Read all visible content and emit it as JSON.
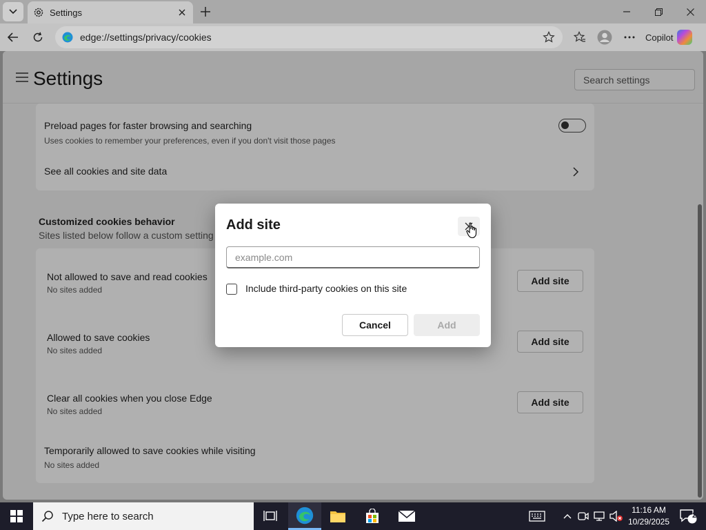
{
  "browser": {
    "tab_title": "Settings",
    "url": "edge://settings/privacy/cookies",
    "copilot_label": "Copilot"
  },
  "header": {
    "title": "Settings",
    "search_placeholder": "Search settings"
  },
  "preload": {
    "title": "Preload pages for faster browsing and searching",
    "subtitle": "Uses cookies to remember your preferences, even if you don't visit those pages",
    "toggle_on": false
  },
  "see_all": {
    "label": "See all cookies and site data"
  },
  "custom": {
    "title": "Customized cookies behavior",
    "subtitle": "Sites listed below follow a custom setting",
    "rows": [
      {
        "title": "Not allowed to save and read cookies",
        "subtitle": "No sites added",
        "button": "Add site"
      },
      {
        "title": "Allowed to save cookies",
        "subtitle": "No sites added",
        "button": "Add site"
      },
      {
        "title": "Clear all cookies when you close Edge",
        "subtitle": "No sites added",
        "button": "Add site"
      }
    ],
    "temp": {
      "title": "Temporarily allowed to save cookies while visiting",
      "subtitle": "No sites added"
    }
  },
  "dialog": {
    "title": "Add site",
    "input_placeholder": "example.com",
    "checkbox_label": "Include third-party cookies on this site",
    "checkbox_checked": false,
    "cancel_label": "Cancel",
    "add_label": "Add"
  },
  "taskbar": {
    "search_placeholder": "Type here to search",
    "time": "11:16 AM",
    "date": "10/29/2025",
    "notification_count": "2"
  }
}
